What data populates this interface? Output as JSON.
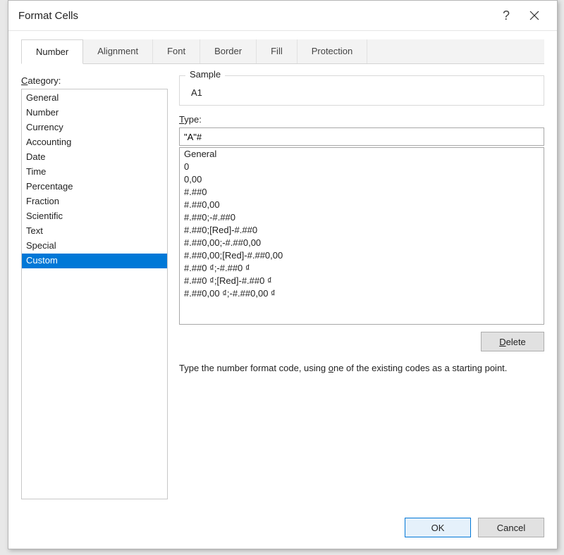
{
  "dialog": {
    "title": "Format Cells"
  },
  "tabs": [
    {
      "label": "Number",
      "active": true
    },
    {
      "label": "Alignment",
      "active": false
    },
    {
      "label": "Font",
      "active": false
    },
    {
      "label": "Border",
      "active": false
    },
    {
      "label": "Fill",
      "active": false
    },
    {
      "label": "Protection",
      "active": false
    }
  ],
  "category": {
    "label_pre": "C",
    "label_post": "ategory:",
    "selected": "Custom",
    "items": [
      "General",
      "Number",
      "Currency",
      "Accounting",
      "Date",
      "Time",
      "Percentage",
      "Fraction",
      "Scientific",
      "Text",
      "Special",
      "Custom"
    ]
  },
  "sample": {
    "legend": "Sample",
    "value": "A1"
  },
  "type": {
    "label_pre": "T",
    "label_post": "ype:",
    "value": "\"A\"#",
    "options": [
      "General",
      "0",
      "0,00",
      "#.##0",
      "#.##0,00",
      "#.##0;-#.##0",
      "#.##0;[Red]-#.##0",
      "#.##0,00;-#.##0,00",
      "#.##0,00;[Red]-#.##0,00",
      "#.##0 ₫;-#.##0 ₫",
      "#.##0 ₫;[Red]-#.##0 ₫",
      "#.##0,00 ₫;-#.##0,00 ₫"
    ]
  },
  "buttons": {
    "delete_pre": "D",
    "delete_post": "elete",
    "ok": "OK",
    "cancel": "Cancel"
  },
  "hint_pre": "Type the number format code, using ",
  "hint_u": "o",
  "hint_post": "ne of the existing codes as a starting point."
}
